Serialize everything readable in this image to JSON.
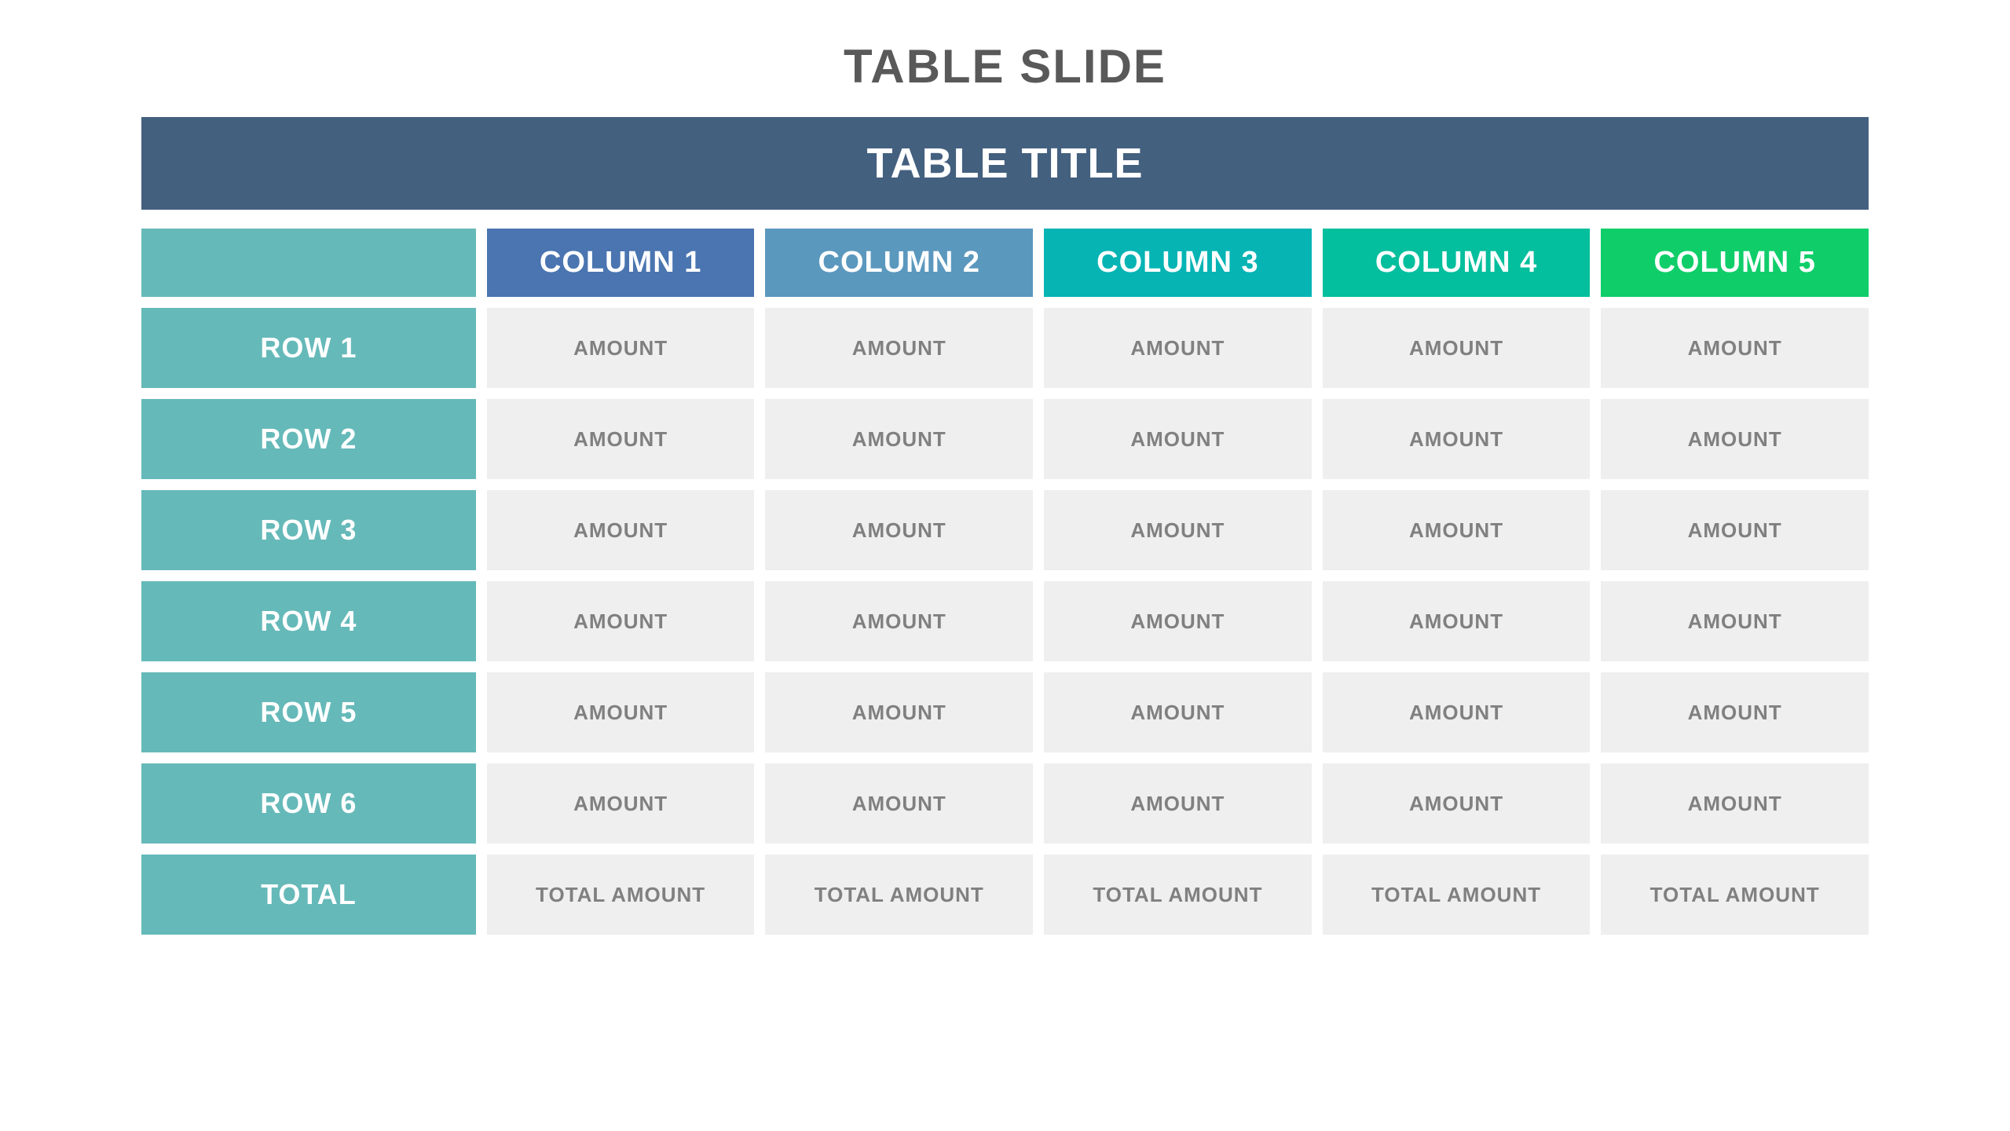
{
  "title": "TABLE SLIDE",
  "table_title": "TABLE TITLE",
  "columns": [
    {
      "label": "COLUMN 1",
      "bg": "#4a75b0"
    },
    {
      "label": "COLUMN 2",
      "bg": "#5b98be"
    },
    {
      "label": "COLUMN 3",
      "bg": "#06b4b4"
    },
    {
      "label": "COLUMN 4",
      "bg": "#04bf9d"
    },
    {
      "label": "COLUMN 5",
      "bg": "#0fce6a"
    }
  ],
  "row_header_bg": "#66b9b9",
  "rows": [
    {
      "label": "ROW 1",
      "cells": [
        "AMOUNT",
        "AMOUNT",
        "AMOUNT",
        "AMOUNT",
        "AMOUNT"
      ]
    },
    {
      "label": "ROW 2",
      "cells": [
        "AMOUNT",
        "AMOUNT",
        "AMOUNT",
        "AMOUNT",
        "AMOUNT"
      ]
    },
    {
      "label": "ROW 3",
      "cells": [
        "AMOUNT",
        "AMOUNT",
        "AMOUNT",
        "AMOUNT",
        "AMOUNT"
      ]
    },
    {
      "label": "ROW 4",
      "cells": [
        "AMOUNT",
        "AMOUNT",
        "AMOUNT",
        "AMOUNT",
        "AMOUNT"
      ]
    },
    {
      "label": "ROW 5",
      "cells": [
        "AMOUNT",
        "AMOUNT",
        "AMOUNT",
        "AMOUNT",
        "AMOUNT"
      ]
    },
    {
      "label": "ROW 6",
      "cells": [
        "AMOUNT",
        "AMOUNT",
        "AMOUNT",
        "AMOUNT",
        "AMOUNT"
      ]
    },
    {
      "label": "TOTAL",
      "cells": [
        "TOTAL AMOUNT",
        "TOTAL AMOUNT",
        "TOTAL AMOUNT",
        "TOTAL AMOUNT",
        "TOTAL AMOUNT"
      ]
    }
  ]
}
